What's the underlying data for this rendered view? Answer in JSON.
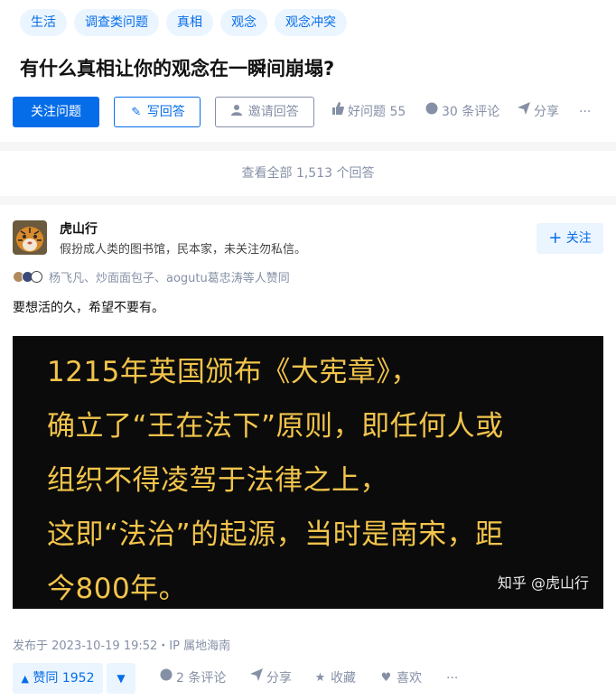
{
  "question": {
    "tags": [
      "生活",
      "调查类问题",
      "真相",
      "观念",
      "观念冲突"
    ],
    "title": "有什么真相让你的观念在一瞬间崩塌?",
    "follow_label": "关注问题",
    "write_label": "写回答",
    "invite_label": "邀请回答",
    "good_question": "好问题 55",
    "comments": "30 条评论",
    "share": "分享",
    "more": "···"
  },
  "view_all": "查看全部 1,513 个回答",
  "answer": {
    "author_name": "虎山行",
    "author_bio": "假扮成人类的图书馆，民本家，未关注勿私信。",
    "follow_label": "关注",
    "voters_text": "杨飞凡、炒面面包子、aogutu葛忠涛等人赞同",
    "text": "要想活的久，希望不要有。",
    "image_lines": [
      "1215年英国颁布《大宪章》，",
      "确立了“王在法下”原则，即任何人或",
      "组织不得凌驾于法律之上，",
      "这即“法治”的起源，当时是南宋，距",
      "今800年。"
    ],
    "image_watermark": "知乎 @虎山行",
    "published": "发布于 2023-10-19 19:52・IP 属地海南",
    "upvote_label": "赞同 1952",
    "comments": "2 条评论",
    "share": "分享",
    "collect": "收藏",
    "like": "喜欢",
    "more": "···"
  },
  "colors": {
    "accent": "#056de8",
    "muted": "#8590a6",
    "tag_bg": "#ebf5ff",
    "image_text": "#f2c44b"
  }
}
